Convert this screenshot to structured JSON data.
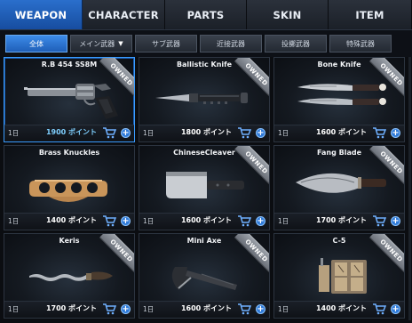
{
  "tabs": [
    {
      "label": "WEAPON",
      "active": true
    },
    {
      "label": "CHARACTER",
      "active": false
    },
    {
      "label": "PARTS",
      "active": false
    },
    {
      "label": "SKIN",
      "active": false
    },
    {
      "label": "ITEM",
      "active": false
    }
  ],
  "subtabs": [
    {
      "label": "全体",
      "active": true
    },
    {
      "label": "メイン武器",
      "active": false,
      "dropdown": "▼"
    },
    {
      "label": "サブ武器",
      "active": false
    },
    {
      "label": "近接武器",
      "active": false
    },
    {
      "label": "投擲武器",
      "active": false
    },
    {
      "label": "特殊武器",
      "active": false
    }
  ],
  "items": [
    {
      "name": "R.B 454 SS8M",
      "owned": "OWNED",
      "duration": "1日",
      "price": "1900 ポイント",
      "icon": "revolver-icon"
    },
    {
      "name": "Ballistic Knife",
      "owned": "OWNED",
      "duration": "1日",
      "price": "1800 ポイント",
      "icon": "ballistic-knife-icon"
    },
    {
      "name": "Bone Knife",
      "owned": "OWNED",
      "duration": "1日",
      "price": "1600 ポイント",
      "icon": "bone-knife-icon"
    },
    {
      "name": "Brass Knuckles",
      "owned": "",
      "duration": "1日",
      "price": "1400 ポイント",
      "icon": "brass-knuckles-icon"
    },
    {
      "name": "ChineseCleaver",
      "owned": "OWNED",
      "duration": "1日",
      "price": "1600 ポイント",
      "icon": "cleaver-icon"
    },
    {
      "name": "Fang Blade",
      "owned": "OWNED",
      "duration": "1日",
      "price": "1700 ポイント",
      "icon": "fang-blade-icon"
    },
    {
      "name": "Keris",
      "owned": "OWNED",
      "duration": "1日",
      "price": "1700 ポイント",
      "icon": "keris-icon"
    },
    {
      "name": "Mini Axe",
      "owned": "OWNED",
      "duration": "1日",
      "price": "1600 ポイント",
      "icon": "mini-axe-icon"
    },
    {
      "name": "C-5",
      "owned": "OWNED",
      "duration": "1日",
      "price": "1400 ポイント",
      "icon": "c5-explosive-icon"
    }
  ],
  "card_actions": {
    "cart_icon": "cart-icon",
    "add_symbol": "+"
  },
  "colors": {
    "accent": "#2a6fcc",
    "selected_border": "#3a9cff"
  }
}
